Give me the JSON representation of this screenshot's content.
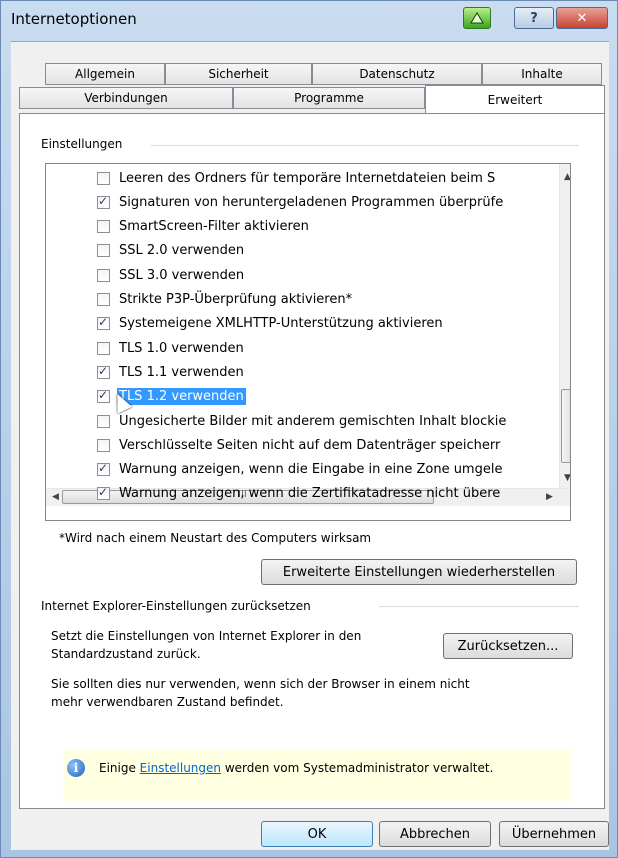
{
  "window": {
    "title": "Internetoptionen"
  },
  "tabs": {
    "row1": [
      "Allgemein",
      "Sicherheit",
      "Datenschutz",
      "Inhalte"
    ],
    "row2": [
      "Verbindungen",
      "Programme",
      "Erweitert"
    ]
  },
  "settings": {
    "group_label": "Einstellungen",
    "items": [
      {
        "label": "Leeren des Ordners für temporäre Internetdateien beim S",
        "checked": false
      },
      {
        "label": "Signaturen von heruntergeladenen Programmen überprüfe",
        "checked": true
      },
      {
        "label": "SmartScreen-Filter aktivieren",
        "checked": false
      },
      {
        "label": "SSL 2.0 verwenden",
        "checked": false
      },
      {
        "label": "SSL 3.0 verwenden",
        "checked": false
      },
      {
        "label": "Strikte P3P-Überprüfung aktivieren*",
        "checked": false
      },
      {
        "label": "Systemeigene XMLHTTP-Unterstützung aktivieren",
        "checked": true
      },
      {
        "label": "TLS 1.0 verwenden",
        "checked": false
      },
      {
        "label": "TLS 1.1 verwenden",
        "checked": true
      },
      {
        "label": "TLS 1.2 verwenden",
        "checked": true
      },
      {
        "label": "Ungesicherte Bilder mit anderem gemischten Inhalt blockie",
        "checked": false
      },
      {
        "label": "Verschlüsselte Seiten nicht auf dem Datenträger speicherr",
        "checked": false
      },
      {
        "label": "Warnung anzeigen, wenn die Eingabe in eine Zone umgele",
        "checked": true
      },
      {
        "label": "Warnung anzeigen, wenn die Zertifikatadresse nicht übere",
        "checked": true
      }
    ],
    "restart_note": "*Wird nach einem Neustart des Computers wirksam",
    "restore_button": "Erweiterte Einstellungen wiederherstellen",
    "hscroll_thumb_mark": "III"
  },
  "reset": {
    "group_label": "Internet Explorer-Einstellungen zurücksetzen",
    "desc_line1": "Setzt die Einstellungen von Internet Explorer in den",
    "desc_line2": "Standardzustand zurück.",
    "reset_button": "Zurücksetzen...",
    "note_line1": "Sie sollten dies nur verwenden, wenn sich der Browser in einem nicht",
    "note_line2": "mehr verwendbaren Zustand befindet."
  },
  "info": {
    "prefix": "Einige ",
    "link": "Einstellungen",
    "suffix": " werden vom Systemadministrator verwaltet."
  },
  "buttons": {
    "ok": "OK",
    "cancel": "Abbrechen",
    "apply": "Übernehmen"
  },
  "icons": {
    "help": "?",
    "close": "✕",
    "info": "i",
    "admin": "shield-icon"
  }
}
